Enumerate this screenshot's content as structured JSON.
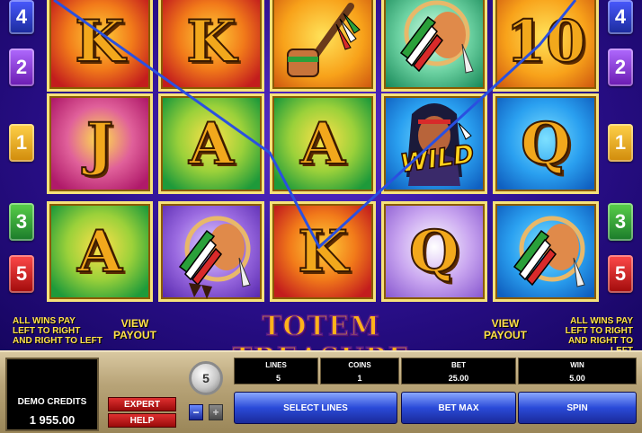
{
  "game": {
    "title": "TOTEM TREASURE",
    "wins_note": [
      "ALL WINS PAY",
      "LEFT TO RIGHT",
      "AND RIGHT TO LEFT"
    ],
    "view_payout": [
      "VIEW",
      "PAYOUT"
    ]
  },
  "line_markers": {
    "left": [
      "4",
      "2",
      "1",
      "3",
      "5"
    ],
    "right": [
      "4",
      "2",
      "1",
      "3",
      "5"
    ]
  },
  "reels": [
    [
      "K",
      "J",
      "A"
    ],
    [
      "K",
      "A",
      "feather-pipe"
    ],
    [
      "peace-pipe",
      "A",
      "K"
    ],
    [
      "feather-pipe",
      "WILD",
      "Q"
    ],
    [
      "10",
      "Q",
      "feather-pipe"
    ]
  ],
  "wild_label": "WILD",
  "panel": {
    "credits_label": "DEMO CREDITS",
    "credits_value": "1 955.00",
    "expert_label": "EXPERT",
    "help_label": "HELP",
    "coin_value": "5",
    "minus_label": "−",
    "plus_label": "+",
    "lines_label": "LINES",
    "lines_value": "5",
    "coins_label": "COINS",
    "coins_value": "1",
    "bet_label": "BET",
    "bet_value": "25.00",
    "win_label": "WIN",
    "win_value": "5.00",
    "select_lines_label": "SELECT LINES",
    "bet_max_label": "BET MAX",
    "spin_label": "SPIN"
  },
  "colors": {
    "marker_4": "#2a3ad0",
    "marker_2": "#8a3ad0",
    "marker_1": "#f0b21a",
    "marker_3": "#2aa03a",
    "marker_5": "#d82a2a",
    "payline": "#2a50e0"
  }
}
